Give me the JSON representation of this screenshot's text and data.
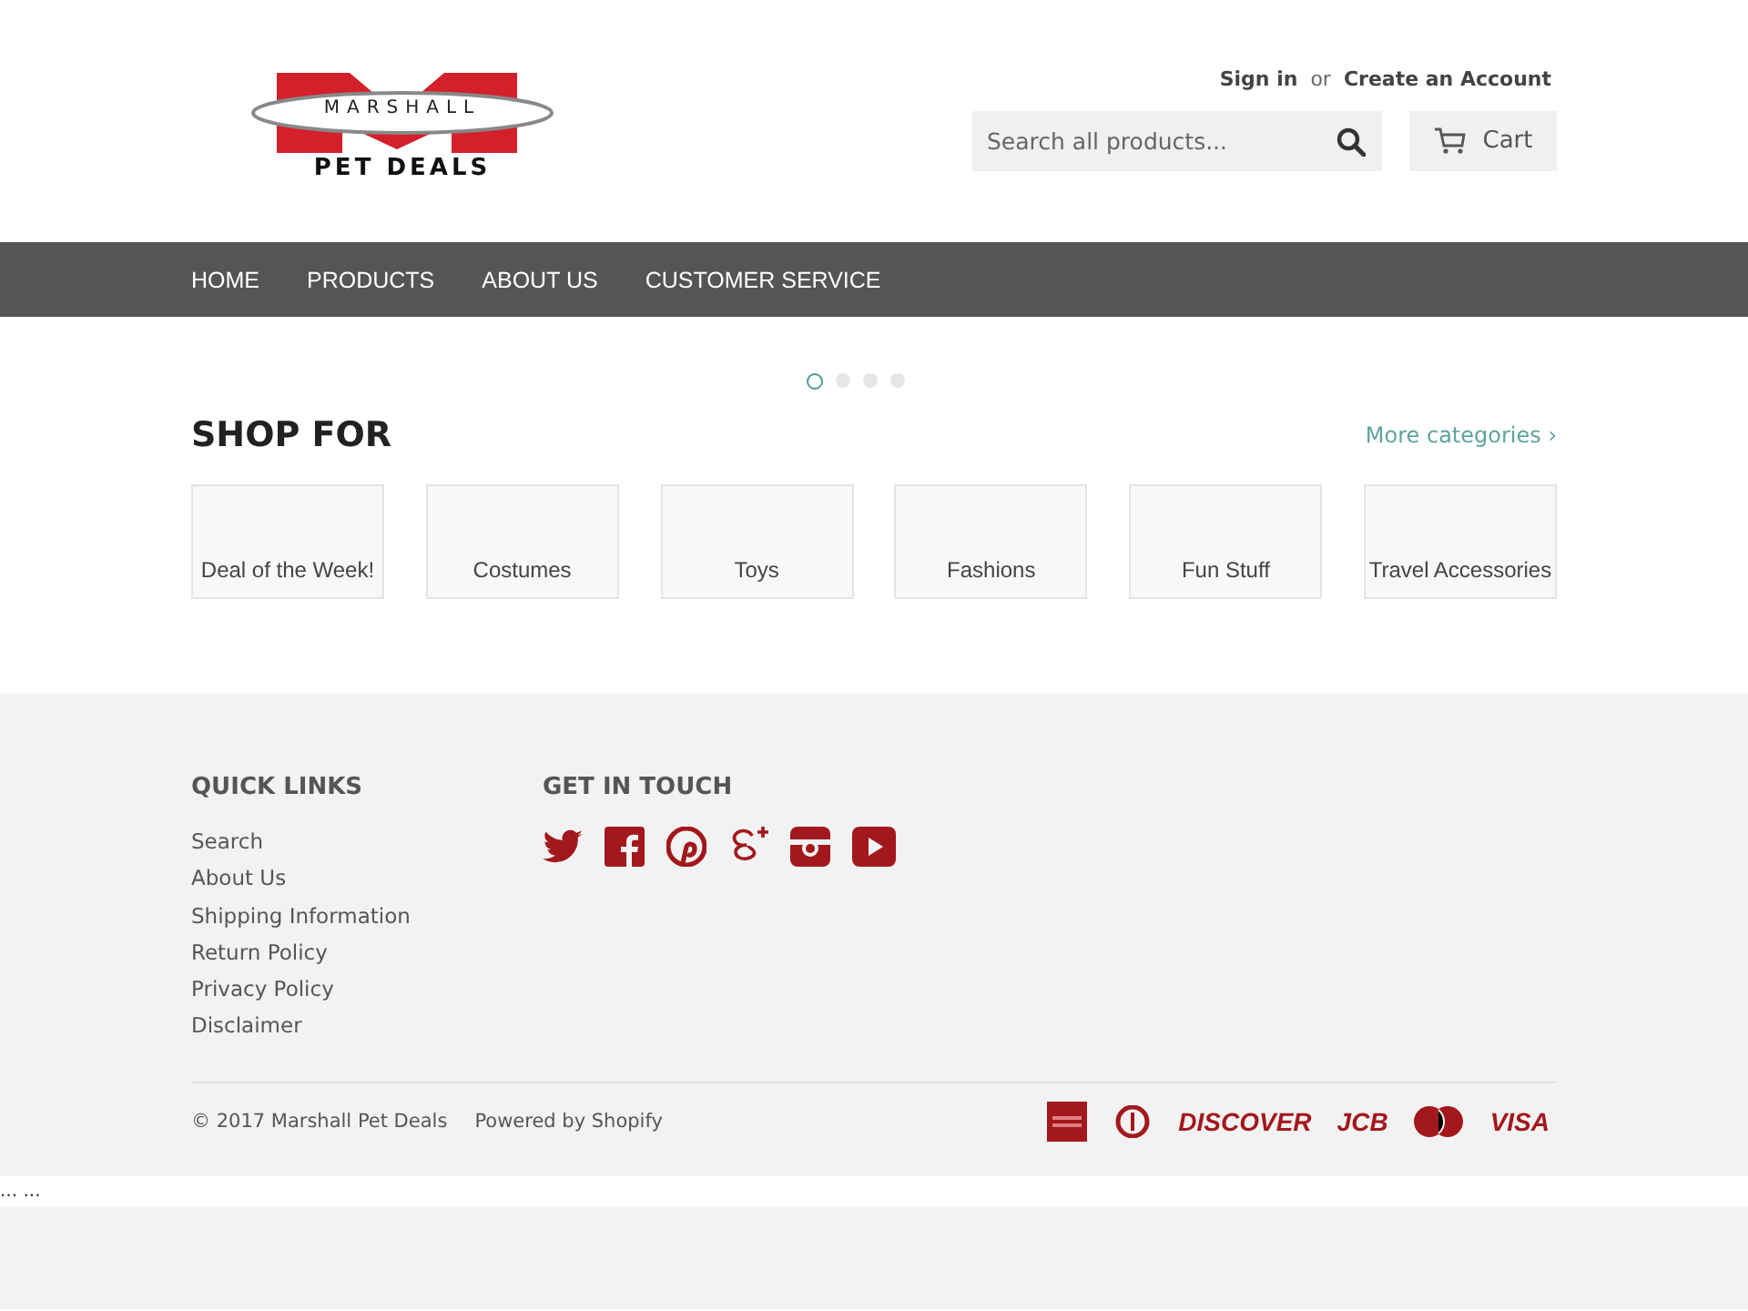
{
  "logo": {
    "top": "MARSHALL",
    "bottom": "PET DEALS"
  },
  "account": {
    "sign_in": "Sign in",
    "or": "or",
    "create": "Create an Account"
  },
  "search": {
    "placeholder": "Search all products..."
  },
  "cart": {
    "label": "Cart"
  },
  "nav": [
    {
      "label": "HOME"
    },
    {
      "label": "PRODUCTS"
    },
    {
      "label": "ABOUT US"
    },
    {
      "label": "CUSTOMER SERVICE"
    }
  ],
  "slider_dots": [
    {
      "selected": true
    },
    {
      "selected": false
    },
    {
      "selected": false
    },
    {
      "selected": false
    }
  ],
  "shop": {
    "title": "SHOP FOR",
    "more": "More categories ›",
    "categories": [
      {
        "label": "Deal of the Week!"
      },
      {
        "label": "Costumes"
      },
      {
        "label": "Toys"
      },
      {
        "label": "Fashions"
      },
      {
        "label": "Fun Stuff"
      },
      {
        "label": "Travel Accessories"
      }
    ]
  },
  "footer": {
    "quick_links": {
      "title": "QUICK LINKS",
      "items": [
        "Search",
        "About Us",
        "Shipping Information",
        "Return Policy",
        "Privacy Policy",
        "Disclaimer"
      ]
    },
    "get_in_touch": {
      "title": "GET IN TOUCH",
      "social": [
        {
          "kind": "twitter"
        },
        {
          "kind": "facebook"
        },
        {
          "kind": "pinterest"
        },
        {
          "kind": "googleplus"
        },
        {
          "kind": "instagram"
        },
        {
          "kind": "youtube"
        }
      ]
    },
    "copyright": "© 2017 Marshall Pet Deals",
    "powered": "Powered by Shopify",
    "payments": [
      {
        "kind": "amex"
      },
      {
        "kind": "diners"
      },
      {
        "kind": "discover",
        "label": "DISCOVER"
      },
      {
        "kind": "jcb",
        "label": "JCB"
      },
      {
        "kind": "mastercard"
      },
      {
        "kind": "visa",
        "label": "VISA"
      }
    ]
  },
  "bottom_text": "... ..."
}
